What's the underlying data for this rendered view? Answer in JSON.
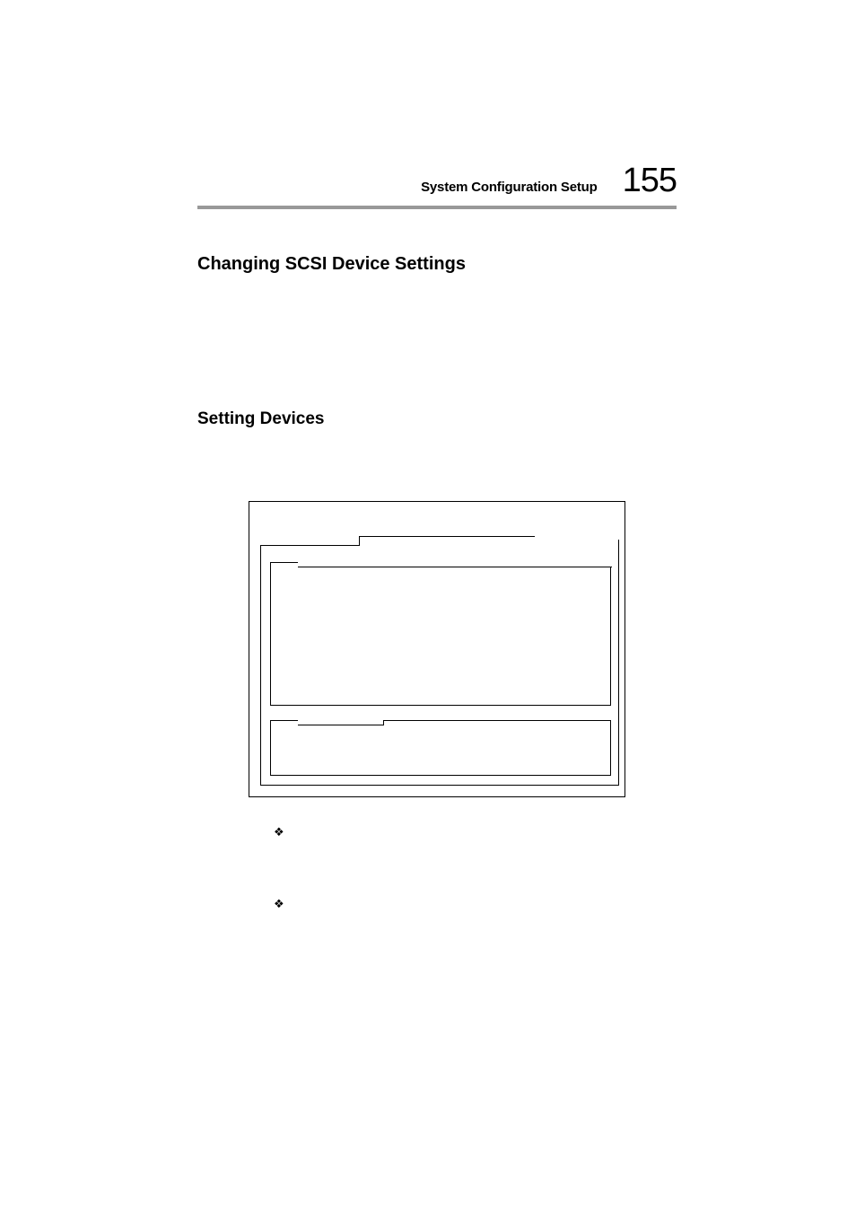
{
  "header": {
    "section_label": "System Configuration Setup",
    "page_number": "155"
  },
  "headings": {
    "h1": "Changing SCSI Device Settings",
    "h2": "Setting Devices"
  },
  "bullets": [
    {
      "text": ""
    },
    {
      "text": ""
    }
  ]
}
